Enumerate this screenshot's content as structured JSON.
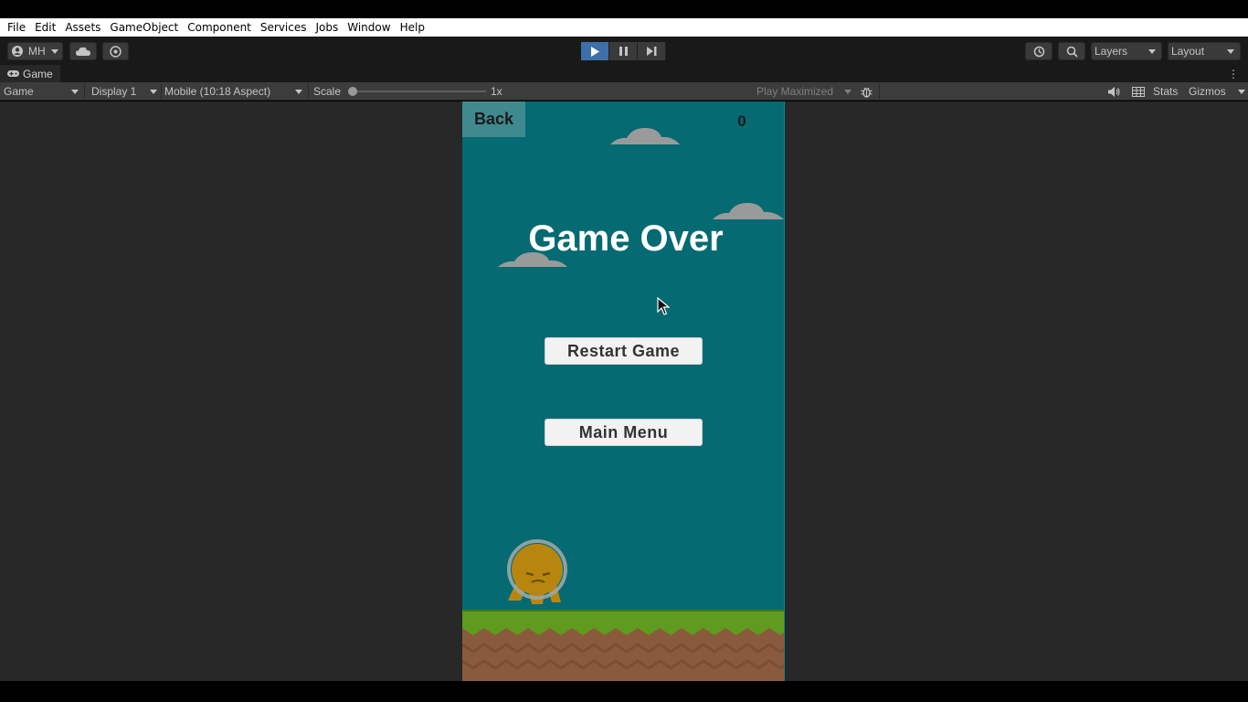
{
  "menu": {
    "items": [
      "File",
      "Edit",
      "Assets",
      "GameObject",
      "Component",
      "Services",
      "Jobs",
      "Window",
      "Help"
    ]
  },
  "toolbar": {
    "account_label": "MH",
    "cloud_icon": "cloud-icon",
    "collab_icon": "collab-icon",
    "play_icon": "play-icon",
    "pause_icon": "pause-icon",
    "step_icon": "step-icon",
    "history_icon": "history-icon",
    "search_icon": "search-icon",
    "layers_label": "Layers",
    "layout_label": "Layout",
    "play_active_color": "#3d6fa8"
  },
  "tab": {
    "label": "Game",
    "icon": "gamepad-icon"
  },
  "gamebar": {
    "view_select": "Game",
    "display_select": "Display 1",
    "aspect_select": "Mobile (10:18 Aspect)",
    "scale_label": "Scale",
    "scale_value": "1x",
    "scale_fraction": 0.0,
    "play_mode_select": "Play Maximized",
    "stats_label": "Stats",
    "gizmos_label": "Gizmos"
  },
  "game": {
    "back_label": "Back",
    "score": "0",
    "title": "Game Over",
    "restart_label": "Restart Game",
    "main_menu_label": "Main Menu",
    "background_color": "#056a72"
  }
}
